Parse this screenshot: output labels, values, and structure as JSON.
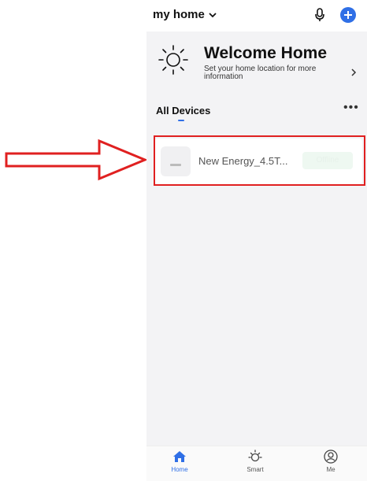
{
  "header": {
    "home_name": "my home"
  },
  "welcome": {
    "title": "Welcome Home",
    "subtitle": "Set your home location for more information"
  },
  "section": {
    "title": "All Devices"
  },
  "device": {
    "name": "New Energy_4.5T...",
    "status": "Offline"
  },
  "tabs": [
    {
      "label": "Home",
      "active": true
    },
    {
      "label": "Smart",
      "active": false
    },
    {
      "label": "Me",
      "active": false
    }
  ],
  "colors": {
    "accent": "#2f6fe6",
    "highlight": "#e02020"
  },
  "icons": [
    "chevron-down-icon",
    "mic-icon",
    "add-icon",
    "sun-icon",
    "chevron-right-icon",
    "more-icon",
    "home-icon",
    "smart-icon",
    "profile-icon",
    "arrow-icon"
  ]
}
